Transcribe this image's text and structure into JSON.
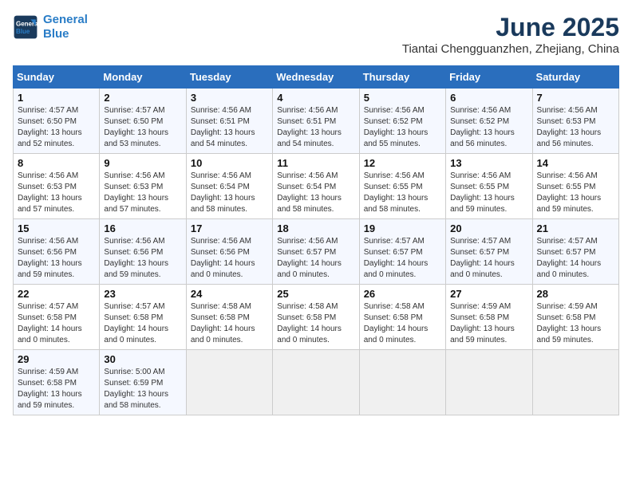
{
  "logo": {
    "line1": "General",
    "line2": "Blue"
  },
  "title": "June 2025",
  "subtitle": "Tiantai Chengguanzhen, Zhejiang, China",
  "days_of_week": [
    "Sunday",
    "Monday",
    "Tuesday",
    "Wednesday",
    "Thursday",
    "Friday",
    "Saturday"
  ],
  "weeks": [
    [
      {
        "day": "1",
        "sunrise": "Sunrise: 4:57 AM",
        "sunset": "Sunset: 6:50 PM",
        "daylight": "Daylight: 13 hours and 52 minutes."
      },
      {
        "day": "2",
        "sunrise": "Sunrise: 4:57 AM",
        "sunset": "Sunset: 6:50 PM",
        "daylight": "Daylight: 13 hours and 53 minutes."
      },
      {
        "day": "3",
        "sunrise": "Sunrise: 4:56 AM",
        "sunset": "Sunset: 6:51 PM",
        "daylight": "Daylight: 13 hours and 54 minutes."
      },
      {
        "day": "4",
        "sunrise": "Sunrise: 4:56 AM",
        "sunset": "Sunset: 6:51 PM",
        "daylight": "Daylight: 13 hours and 54 minutes."
      },
      {
        "day": "5",
        "sunrise": "Sunrise: 4:56 AM",
        "sunset": "Sunset: 6:52 PM",
        "daylight": "Daylight: 13 hours and 55 minutes."
      },
      {
        "day": "6",
        "sunrise": "Sunrise: 4:56 AM",
        "sunset": "Sunset: 6:52 PM",
        "daylight": "Daylight: 13 hours and 56 minutes."
      },
      {
        "day": "7",
        "sunrise": "Sunrise: 4:56 AM",
        "sunset": "Sunset: 6:53 PM",
        "daylight": "Daylight: 13 hours and 56 minutes."
      }
    ],
    [
      {
        "day": "8",
        "sunrise": "Sunrise: 4:56 AM",
        "sunset": "Sunset: 6:53 PM",
        "daylight": "Daylight: 13 hours and 57 minutes."
      },
      {
        "day": "9",
        "sunrise": "Sunrise: 4:56 AM",
        "sunset": "Sunset: 6:53 PM",
        "daylight": "Daylight: 13 hours and 57 minutes."
      },
      {
        "day": "10",
        "sunrise": "Sunrise: 4:56 AM",
        "sunset": "Sunset: 6:54 PM",
        "daylight": "Daylight: 13 hours and 58 minutes."
      },
      {
        "day": "11",
        "sunrise": "Sunrise: 4:56 AM",
        "sunset": "Sunset: 6:54 PM",
        "daylight": "Daylight: 13 hours and 58 minutes."
      },
      {
        "day": "12",
        "sunrise": "Sunrise: 4:56 AM",
        "sunset": "Sunset: 6:55 PM",
        "daylight": "Daylight: 13 hours and 58 minutes."
      },
      {
        "day": "13",
        "sunrise": "Sunrise: 4:56 AM",
        "sunset": "Sunset: 6:55 PM",
        "daylight": "Daylight: 13 hours and 59 minutes."
      },
      {
        "day": "14",
        "sunrise": "Sunrise: 4:56 AM",
        "sunset": "Sunset: 6:55 PM",
        "daylight": "Daylight: 13 hours and 59 minutes."
      }
    ],
    [
      {
        "day": "15",
        "sunrise": "Sunrise: 4:56 AM",
        "sunset": "Sunset: 6:56 PM",
        "daylight": "Daylight: 13 hours and 59 minutes."
      },
      {
        "day": "16",
        "sunrise": "Sunrise: 4:56 AM",
        "sunset": "Sunset: 6:56 PM",
        "daylight": "Daylight: 13 hours and 59 minutes."
      },
      {
        "day": "17",
        "sunrise": "Sunrise: 4:56 AM",
        "sunset": "Sunset: 6:56 PM",
        "daylight": "Daylight: 14 hours and 0 minutes."
      },
      {
        "day": "18",
        "sunrise": "Sunrise: 4:56 AM",
        "sunset": "Sunset: 6:57 PM",
        "daylight": "Daylight: 14 hours and 0 minutes."
      },
      {
        "day": "19",
        "sunrise": "Sunrise: 4:57 AM",
        "sunset": "Sunset: 6:57 PM",
        "daylight": "Daylight: 14 hours and 0 minutes."
      },
      {
        "day": "20",
        "sunrise": "Sunrise: 4:57 AM",
        "sunset": "Sunset: 6:57 PM",
        "daylight": "Daylight: 14 hours and 0 minutes."
      },
      {
        "day": "21",
        "sunrise": "Sunrise: 4:57 AM",
        "sunset": "Sunset: 6:57 PM",
        "daylight": "Daylight: 14 hours and 0 minutes."
      }
    ],
    [
      {
        "day": "22",
        "sunrise": "Sunrise: 4:57 AM",
        "sunset": "Sunset: 6:58 PM",
        "daylight": "Daylight: 14 hours and 0 minutes."
      },
      {
        "day": "23",
        "sunrise": "Sunrise: 4:57 AM",
        "sunset": "Sunset: 6:58 PM",
        "daylight": "Daylight: 14 hours and 0 minutes."
      },
      {
        "day": "24",
        "sunrise": "Sunrise: 4:58 AM",
        "sunset": "Sunset: 6:58 PM",
        "daylight": "Daylight: 14 hours and 0 minutes."
      },
      {
        "day": "25",
        "sunrise": "Sunrise: 4:58 AM",
        "sunset": "Sunset: 6:58 PM",
        "daylight": "Daylight: 14 hours and 0 minutes."
      },
      {
        "day": "26",
        "sunrise": "Sunrise: 4:58 AM",
        "sunset": "Sunset: 6:58 PM",
        "daylight": "Daylight: 14 hours and 0 minutes."
      },
      {
        "day": "27",
        "sunrise": "Sunrise: 4:59 AM",
        "sunset": "Sunset: 6:58 PM",
        "daylight": "Daylight: 13 hours and 59 minutes."
      },
      {
        "day": "28",
        "sunrise": "Sunrise: 4:59 AM",
        "sunset": "Sunset: 6:58 PM",
        "daylight": "Daylight: 13 hours and 59 minutes."
      }
    ],
    [
      {
        "day": "29",
        "sunrise": "Sunrise: 4:59 AM",
        "sunset": "Sunset: 6:58 PM",
        "daylight": "Daylight: 13 hours and 59 minutes."
      },
      {
        "day": "30",
        "sunrise": "Sunrise: 5:00 AM",
        "sunset": "Sunset: 6:59 PM",
        "daylight": "Daylight: 13 hours and 58 minutes."
      },
      null,
      null,
      null,
      null,
      null
    ]
  ]
}
